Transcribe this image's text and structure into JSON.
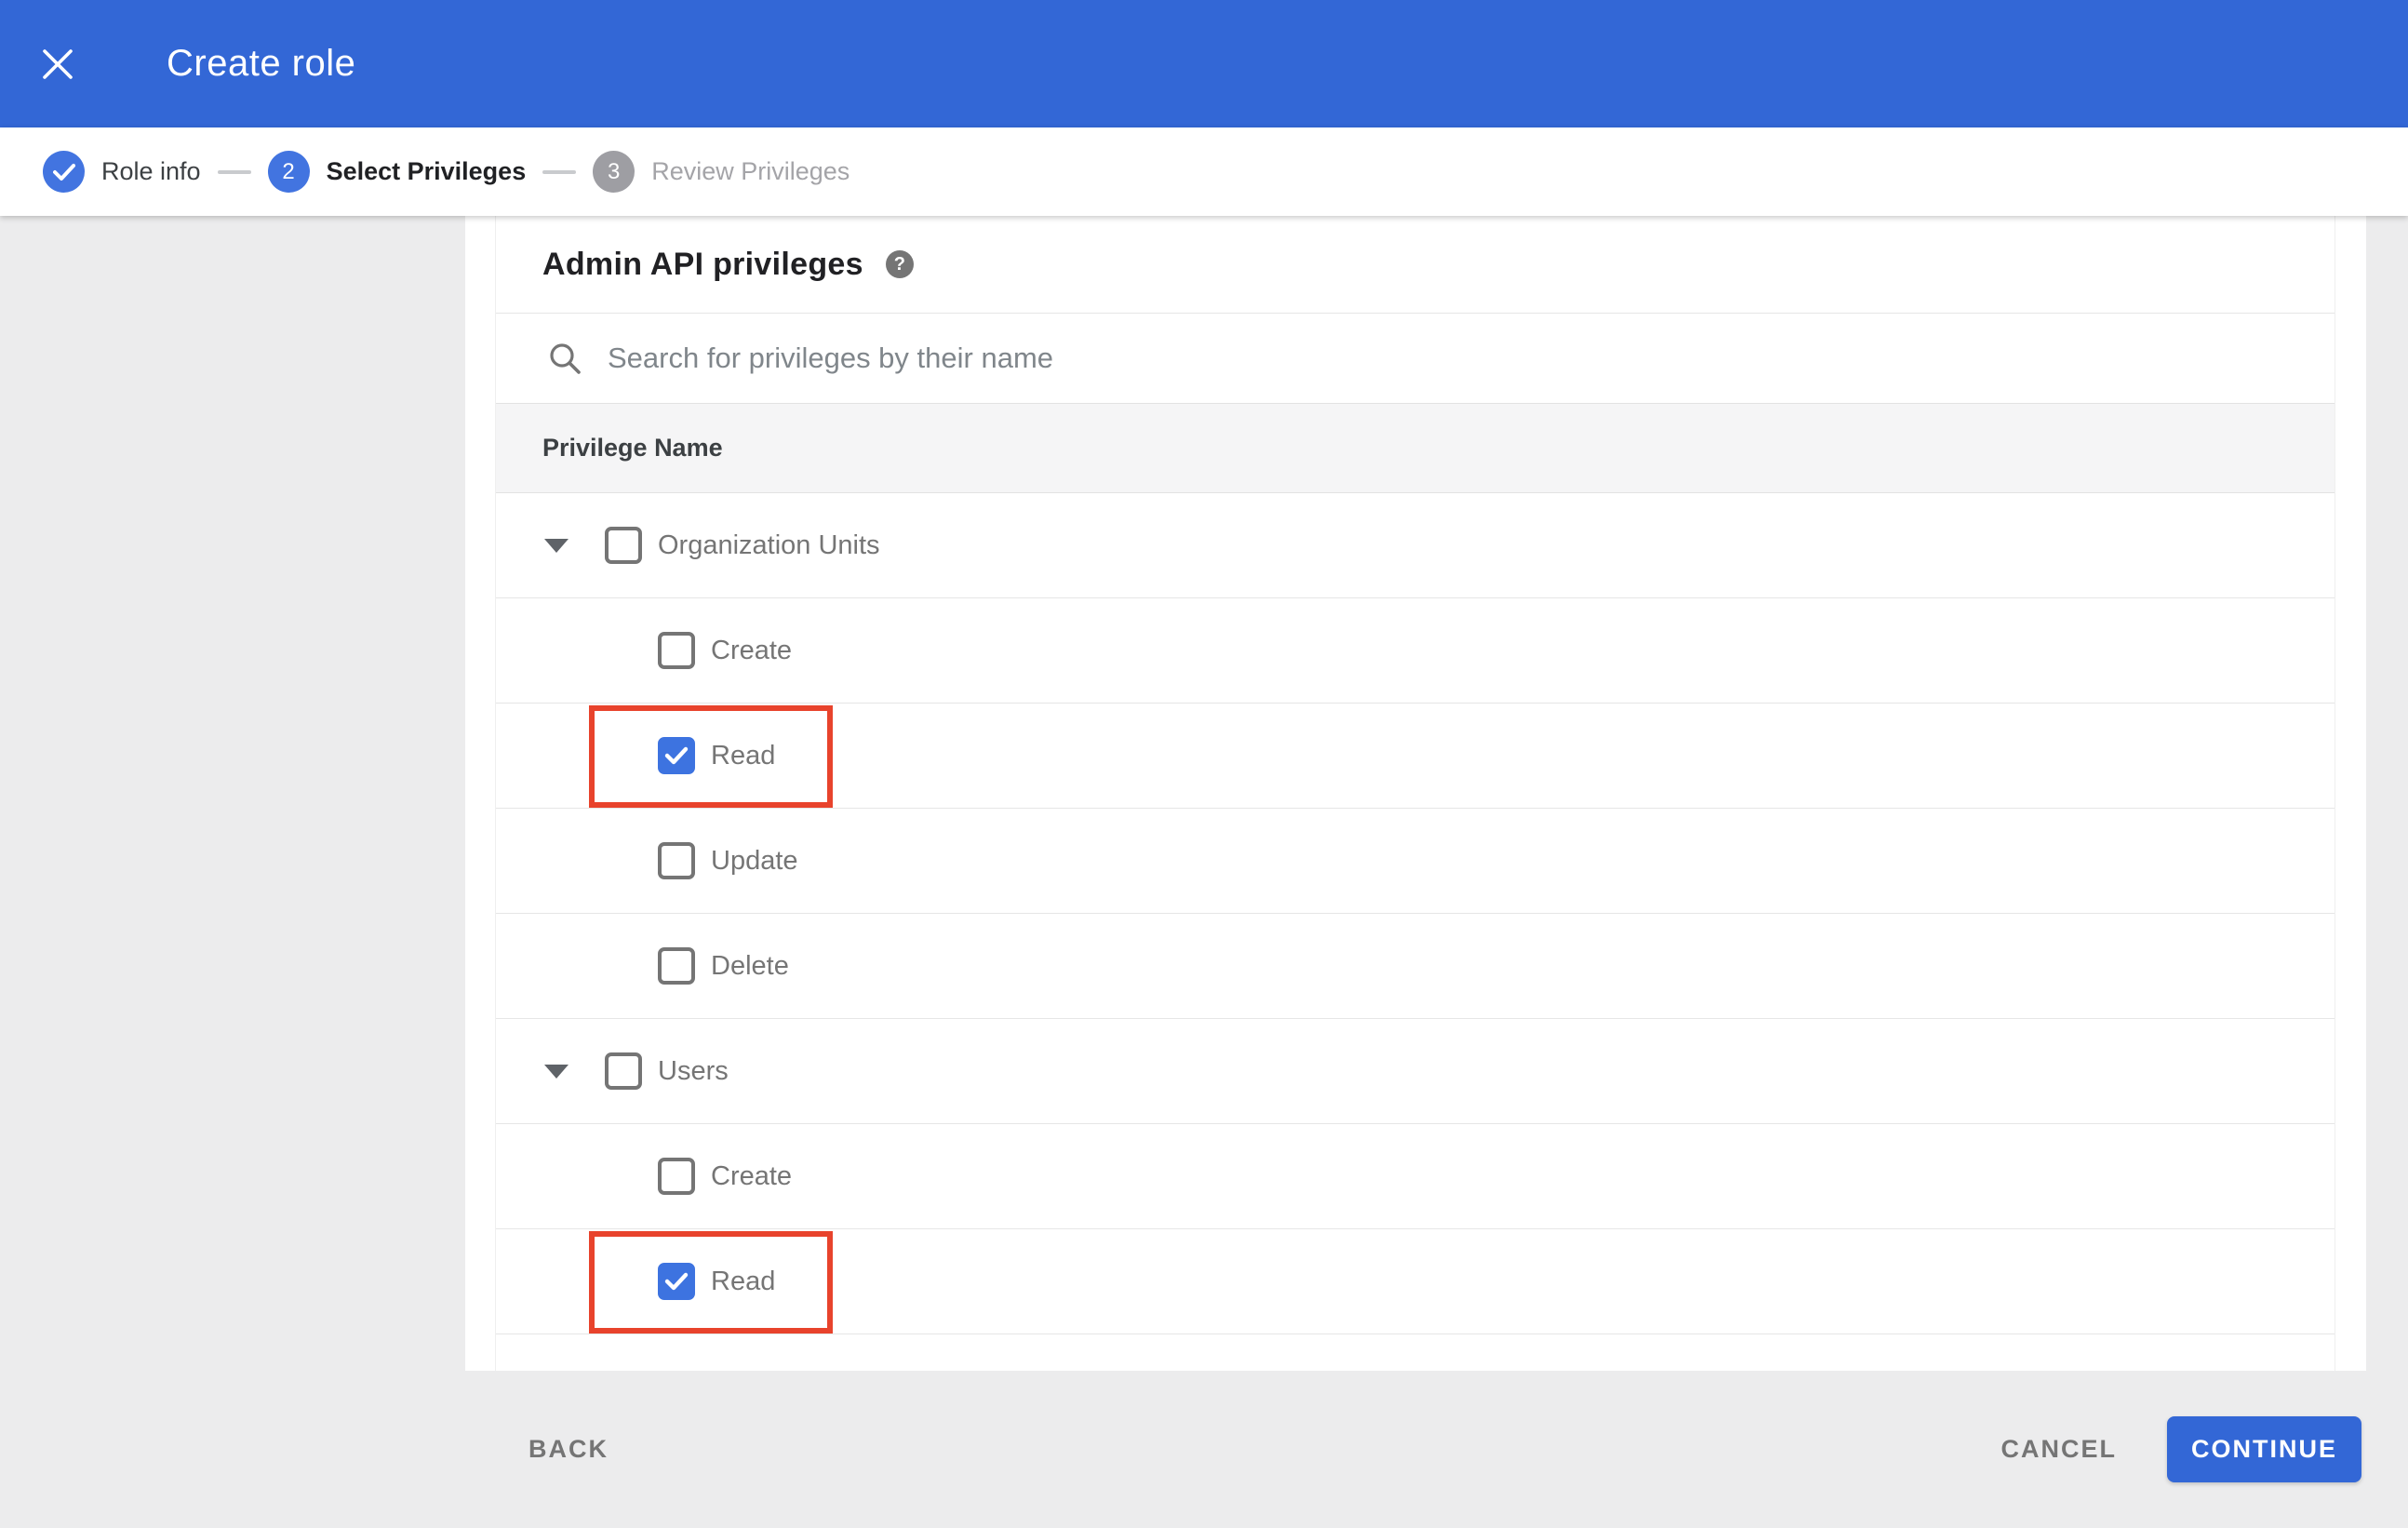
{
  "colors": {
    "appbar_blue": "#3367d6",
    "control_blue": "#4274e0",
    "checkbox_blue": "#3d73e0",
    "continue_blue": "#3367d6",
    "annotation_red": "#e8432c",
    "page_gray": "#ececed",
    "thead_gray": "#f5f5f6",
    "divider": "#e6e6e6",
    "label_gray": "#757575",
    "dark_text": "#212124"
  },
  "appbar": {
    "title": "Create role"
  },
  "stepper": {
    "steps": [
      {
        "number": "1",
        "label": "Role info",
        "state": "completed"
      },
      {
        "number": "2",
        "label": "Select Privileges",
        "state": "active"
      },
      {
        "number": "3",
        "label": "Review Privileges",
        "state": "upcoming"
      }
    ]
  },
  "privileges_panel": {
    "title": "Admin API privileges",
    "help_icon": "?",
    "search": {
      "placeholder": "Search for privileges by their name"
    },
    "table": {
      "header": "Privilege Name",
      "rows": [
        {
          "type": "group",
          "label": "Organization Units",
          "checked": false,
          "expanded": true,
          "highlighted": false
        },
        {
          "type": "child",
          "label": "Create",
          "checked": false,
          "highlighted": false
        },
        {
          "type": "child",
          "label": "Read",
          "checked": true,
          "highlighted": true
        },
        {
          "type": "child",
          "label": "Update",
          "checked": false,
          "highlighted": false
        },
        {
          "type": "child",
          "label": "Delete",
          "checked": false,
          "highlighted": false
        },
        {
          "type": "group",
          "label": "Users",
          "checked": false,
          "expanded": true,
          "highlighted": false
        },
        {
          "type": "child",
          "label": "Create",
          "checked": false,
          "highlighted": false
        },
        {
          "type": "child",
          "label": "Read",
          "checked": true,
          "highlighted": true
        }
      ]
    }
  },
  "footer": {
    "back": "BACK",
    "cancel": "CANCEL",
    "continue": "CONTINUE"
  }
}
